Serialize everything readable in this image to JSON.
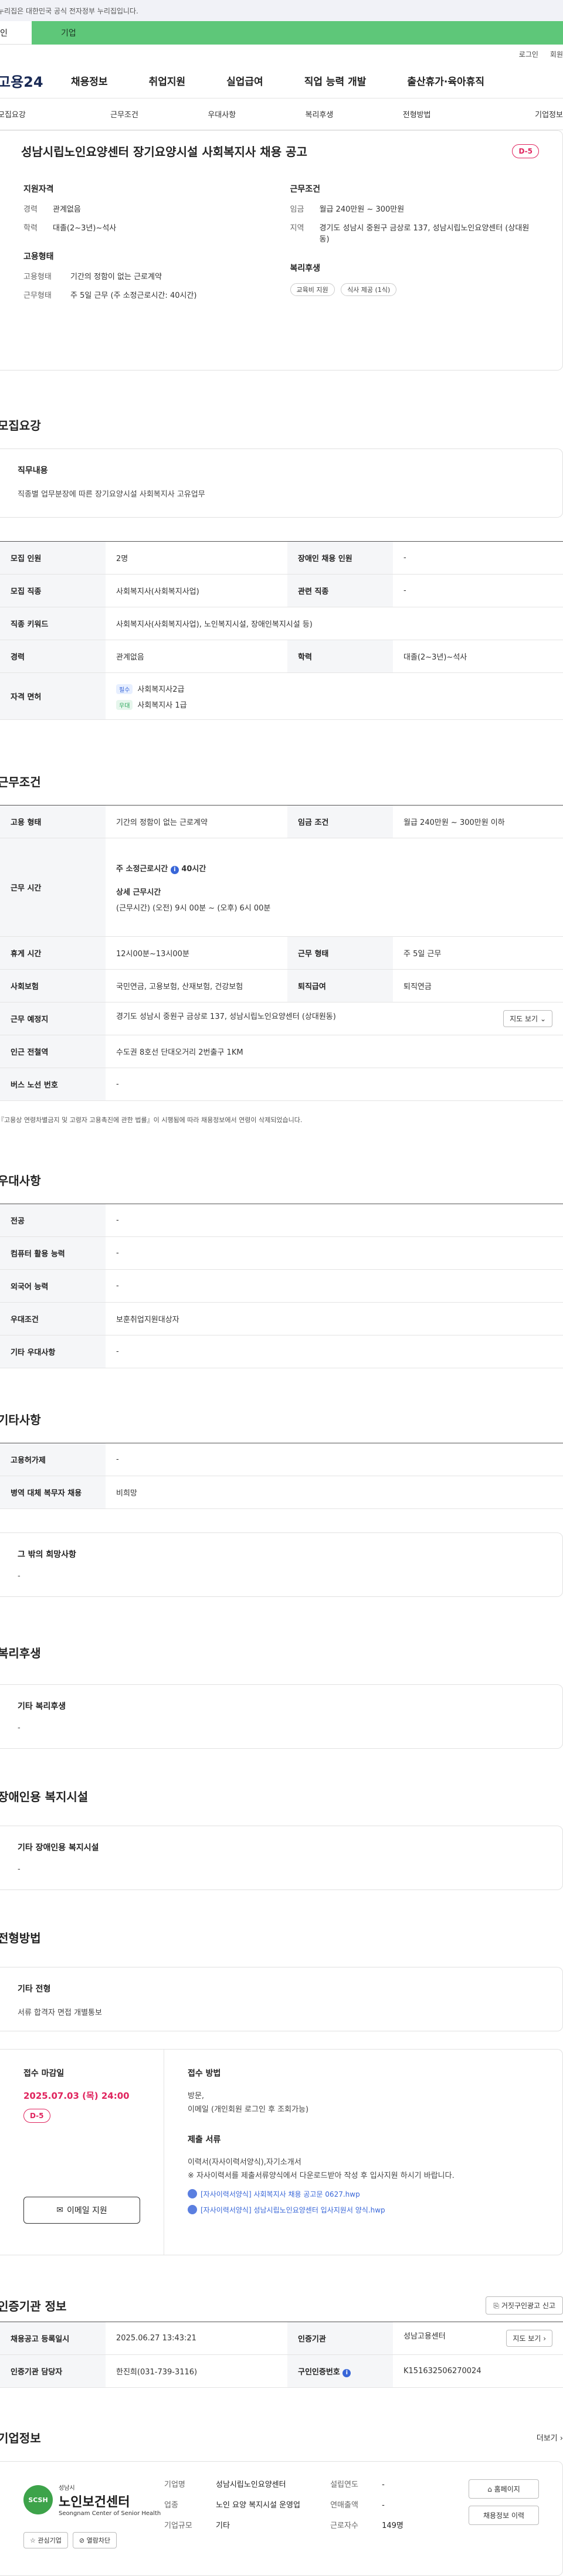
{
  "gov_banner": "누리집은 대한민국 공식 전자정부 누리집입니다.",
  "tabs": {
    "left": "인",
    "right": "기업"
  },
  "util": {
    "login": "로그인",
    "join": "회원"
  },
  "logo": "고용24",
  "gnb": [
    "채용정보",
    "취업지원",
    "실업급여",
    "직업 능력 개발",
    "출산휴가·육아휴직"
  ],
  "subnav": [
    "모집요강",
    "근무조건",
    "우대사항",
    "복리후생",
    "전형방법",
    "기업정보"
  ],
  "headline": {
    "title": "성남시립노인요양센터 장기요양시설 사회복지사 채용 공고",
    "dday": "D-5",
    "qual_title": "지원자격",
    "qual": [
      {
        "k": "경력",
        "v": "관계없음"
      },
      {
        "k": "학력",
        "v": "대졸(2~3년)~석사"
      }
    ],
    "cond_title": "근무조건",
    "cond": [
      {
        "k": "임금",
        "v": "월급 240만원 ~ 300만원"
      },
      {
        "k": "지역",
        "v": "경기도 성남시 중원구 금상로 137, 성남시립노인요양센터 (상대원동)"
      }
    ],
    "emp_title": "고용형태",
    "emp": [
      {
        "k": "고용형태",
        "v": "기간의 정함이 없는 근로계약"
      },
      {
        "k": "근무형태",
        "v": "주 5일 근무 (주 소정근로시간: 40시간)"
      }
    ],
    "welfare_title": "복리후생",
    "welfare_chips": [
      "교육비 지원",
      "식사 제공 (1식)"
    ]
  },
  "recruit": {
    "title": "모집요강",
    "duty_title": "직무내용",
    "duty_text": "직종별 업무분장에 따른 장기요양시설 사회복지사 고유업무",
    "rows": {
      "count_k": "모집 인원",
      "count_v": "2명",
      "disabled_k": "장애인 채용 인원",
      "disabled_v": "-",
      "job_k": "모집 직종",
      "job_v": "사회복지사(사회복지사업)",
      "rel_k": "관련 직종",
      "rel_v": "-",
      "kw_k": "직종 키워드",
      "kw_v": "사회복지사(사회복지사업), 노인복지시설, 장애인복지시설 등)",
      "career_k": "경력",
      "career_v": "관계없음",
      "edu_k": "학력",
      "edu_v": "대졸(2~3년)~석사",
      "lic_k": "자격 면허",
      "lic_must": "필수",
      "lic_must_v": "사회복지사2급",
      "lic_pref": "우대",
      "lic_pref_v": "사회복지사 1급"
    }
  },
  "work": {
    "title": "근무조건",
    "emp_k": "고용 형태",
    "emp_v": "기간의 정함이 없는 근로계약",
    "wage_k": "임금 조건",
    "wage_v": "월급 240만원 ~ 300만원 이하",
    "time_k": "근무 시간",
    "time_main": "주 소정근로시간",
    "time_hours": "40시간",
    "time_detail_title": "상세 근무시간",
    "time_detail": "(근무시간) (오전) 9시 00분 ~ (오후) 6시 00분",
    "rest_k": "휴게 시간",
    "rest_v": "12시00분~13시00분",
    "form_k": "근무 형태",
    "form_v": "주 5일 근무",
    "ins_k": "사회보험",
    "ins_v": "국민연금, 고용보험, 산재보험, 건강보험",
    "retire_k": "퇴직급여",
    "retire_v": "퇴직연금",
    "place_k": "근무 예정지",
    "place_v": "경기도 성남시 중원구 금상로 137, 성남시립노인요양센터 (상대원동)",
    "map_btn": "지도 보기",
    "station_k": "인근 전철역",
    "station_v": "수도권 8호선 단대오거리 2번출구 1KM",
    "bus_k": "버스 노선 번호",
    "bus_v": "-",
    "note": "『고용상 연령차별금지 및 고령자 고용촉진에 관한 법률』이 시행됨에 따라 채용정보에서 연령이 삭제되었습니다."
  },
  "pref": {
    "title": "우대사항",
    "rows": [
      {
        "k": "전공",
        "v": "-"
      },
      {
        "k": "컴퓨터 활용 능력",
        "v": "-"
      },
      {
        "k": "외국어 능력",
        "v": "-"
      },
      {
        "k": "우대조건",
        "v": "보훈취업지원대상자"
      },
      {
        "k": "기타 우대사항",
        "v": "-"
      }
    ]
  },
  "etc": {
    "title": "기타사항",
    "rows": [
      {
        "k": "고용허가제",
        "v": "-"
      },
      {
        "k": "병역 대체 복무자 채용",
        "v": "비희망"
      }
    ],
    "other_title": "그 밖의 희망사항",
    "other_v": "-"
  },
  "welfare": {
    "title": "복리후생",
    "box_title": "기타 복리후생",
    "box_v": "-"
  },
  "disabled": {
    "title": "장애인용 복지시설",
    "box_title": "기타 장애인용 복지시설",
    "box_v": "-"
  },
  "process": {
    "title": "전형방법",
    "box_title": "기타 전형",
    "box_v": "서류 합격자 면접 개별통보"
  },
  "receipt": {
    "deadline_label": "접수 마감일",
    "deadline": "2025.07.03 (목) 24:00",
    "dday": "D-5",
    "apply_btn": "이메일 지원",
    "method_label": "접수 방법",
    "method_1": "방문,",
    "method_2": "이메일 (개인회원 로그인 후 조회가능)",
    "docs_label": "제출 서류",
    "docs_1": "이력서(자사이력서양식),자기소개서",
    "docs_2": "※ 자사이력서를 제출서류양식에서 다운로드받아 작성 후 입사지원 하시기 바랍니다.",
    "file_1": "[자사이력서양식] 사회복지사 채용 공고문 0627.hwp",
    "file_2": "[자사이력서양식] 성남시립노인요양센터 입사지원서 양식.hwp"
  },
  "agency": {
    "title": "인증기관 정보",
    "report_btn": "거짓구인광고 신고",
    "reg_k": "채용공고 등록일시",
    "reg_v": "2025.06.27 13:43:21",
    "org_k": "인증기관",
    "org_v": "성남고용센터",
    "map_btn": "지도 보기",
    "mgr_k": "인증기관 담당자",
    "mgr_v": "한진희(031-739-3116)",
    "no_k": "구인인증번호",
    "no_v": "K151632506270024"
  },
  "company": {
    "title": "기업정보",
    "more": "더보기",
    "logo_small": "성남시",
    "logo_big": "노인보건센터",
    "logo_sub": "Seongnam Center of Senior Health",
    "fav_btn": "관심기업",
    "block_btn": "열람차단",
    "name_k": "기업명",
    "name_v": "성남시립노인요양센터",
    "biz_k": "업종",
    "biz_v": "노인 요양 복지시설 운영업",
    "size_k": "기업규모",
    "size_v": "기타",
    "found_k": "설립연도",
    "found_v": "-",
    "sales_k": "연매출액",
    "sales_v": "-",
    "staff_k": "근로자수",
    "staff_v": "149명",
    "home_btn": "홈페이지",
    "jobs_btn": "채용정보 이력"
  }
}
